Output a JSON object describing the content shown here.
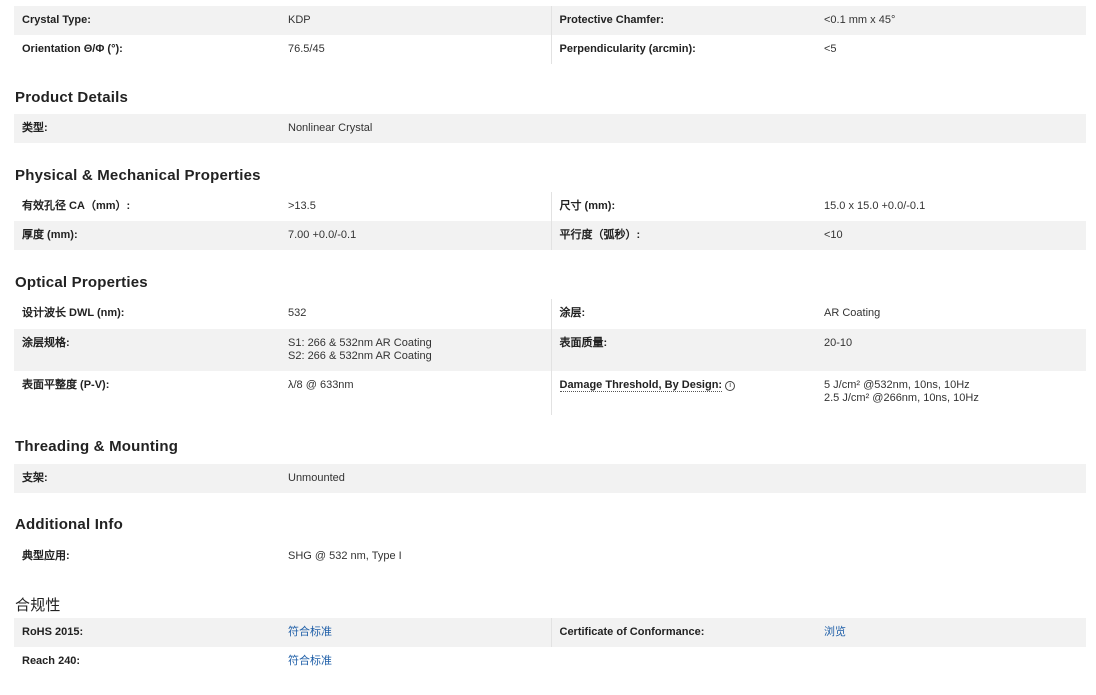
{
  "general": {
    "crystal_type_label": "Crystal Type:",
    "crystal_type_value": "KDP",
    "protective_chamfer_label": "Protective Chamfer:",
    "protective_chamfer_value": "<0.1 mm x 45°",
    "orientation_label": "Orientation Θ/Φ (°):",
    "orientation_value": "76.5/45",
    "perpendicularity_label": "Perpendicularity (arcmin):",
    "perpendicularity_value": "<5"
  },
  "product_details": {
    "title": "Product Details",
    "type_label": "类型:",
    "type_value": "Nonlinear Crystal"
  },
  "physical": {
    "title": "Physical & Mechanical Properties",
    "ca_label": "有效孔径 CA（mm）:",
    "ca_value": ">13.5",
    "size_label": "尺寸 (mm):",
    "size_value": "15.0 x 15.0 +0.0/-0.1",
    "thickness_label": "厚度 (mm):",
    "thickness_value": "7.00 +0.0/-0.1",
    "parallelism_label": "平行度（弧秒）:",
    "parallelism_value": "<10"
  },
  "optical": {
    "title": "Optical Properties",
    "dwl_label": "设计波长 DWL (nm):",
    "dwl_value": "532",
    "coating_label": "涂层:",
    "coating_value": "AR Coating",
    "coating_spec_label": "涂层规格:",
    "coating_spec_s1": "S1: 266 & 532nm AR Coating",
    "coating_spec_s2": "S2: 266 & 532nm AR Coating",
    "surface_quality_label": "表面质量:",
    "surface_quality_value": "20-10",
    "flatness_label": "表面平整度 (P-V):",
    "flatness_value": "λ/8 @ 633nm",
    "damage_label": "Damage Threshold, By Design:",
    "damage_line1": "5 J/cm² @532nm, 10ns, 10Hz",
    "damage_line2": "2.5 J/cm² @266nm, 10ns, 10Hz",
    "info_icon": "i"
  },
  "threading": {
    "title": "Threading & Mounting",
    "mount_label": "支架:",
    "mount_value": "Unmounted"
  },
  "additional": {
    "title": "Additional Info",
    "application_label": "典型应用:",
    "application_value": "SHG @ 532 nm, Type I"
  },
  "compliance": {
    "title": "合规性",
    "rohs_label": "RoHS 2015:",
    "rohs_value": "符合标准",
    "coc_label": "Certificate of Conformance:",
    "coc_value": "浏览",
    "reach_label": "Reach 240:",
    "reach_value": "符合标准"
  },
  "colors": {
    "row_shade": "#f2f2f2",
    "link": "#1f5fa8",
    "text": "#222222"
  }
}
